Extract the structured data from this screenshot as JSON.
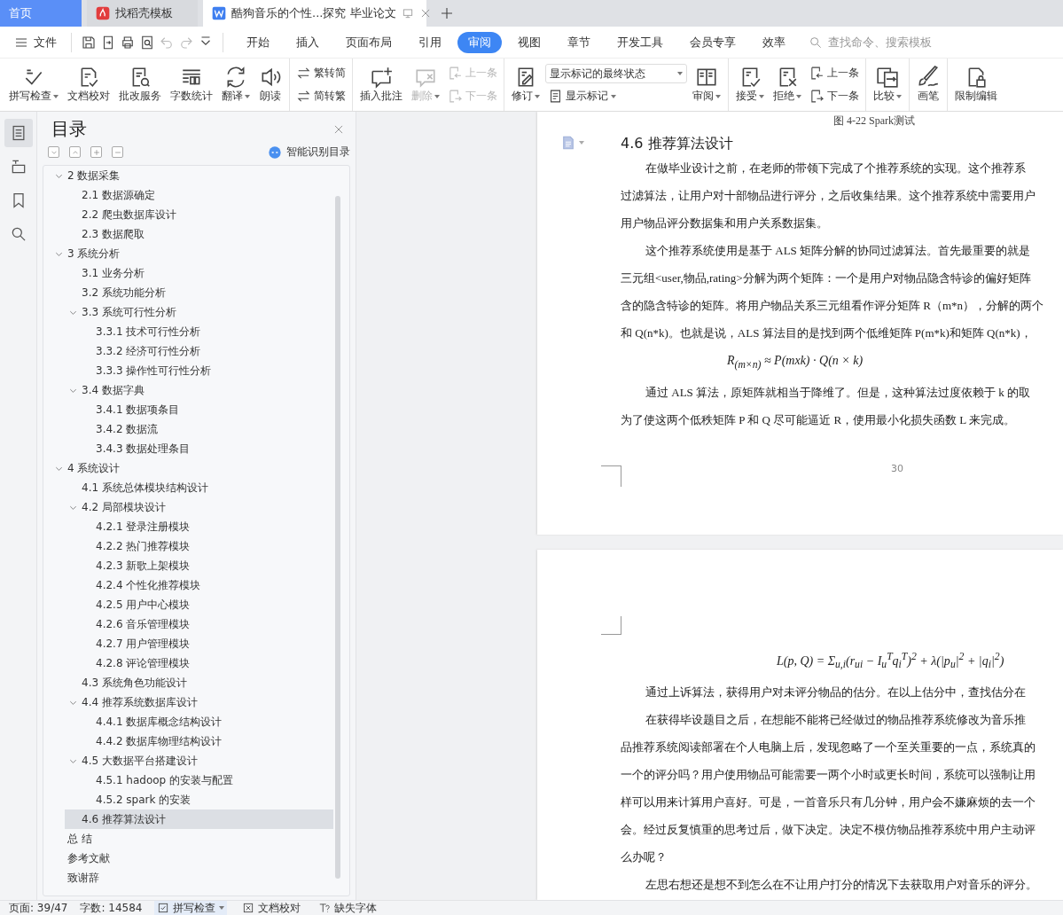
{
  "tabs": [
    {
      "kind": "home",
      "label": "首页",
      "selected": false
    },
    {
      "kind": "store",
      "label": "找稻壳模板",
      "selected": false
    },
    {
      "kind": "document",
      "label": "酷狗音乐的个性...探究 毕业论文",
      "selected": true
    }
  ],
  "menu_bar": {
    "file_menu": "文件",
    "quick_access": [
      {
        "disabled": false
      },
      {
        "disabled": false
      },
      {
        "disabled": false
      },
      {
        "disabled": false
      },
      {
        "disabled": true
      },
      {
        "disabled": true
      },
      {
        "disabled": false
      }
    ],
    "ribbon_tabs": [
      {
        "label": "开始",
        "selected": false
      },
      {
        "label": "插入",
        "selected": false
      },
      {
        "label": "页面布局",
        "selected": false
      },
      {
        "label": "引用",
        "selected": false
      },
      {
        "label": "审阅",
        "selected": true
      },
      {
        "label": "视图",
        "selected": false
      },
      {
        "label": "章节",
        "selected": false
      },
      {
        "label": "开发工具",
        "selected": false
      },
      {
        "label": "会员专享",
        "selected": false
      },
      {
        "label": "效率",
        "selected": false
      }
    ],
    "search": {
      "placeholder": "查找命令、搜索模板"
    }
  },
  "ribbon": {
    "groups": [
      {
        "tools": [
          {
            "kind": "large",
            "label": "拼写检查",
            "dropdown": true,
            "disabled": false
          },
          {
            "kind": "large",
            "label": "文档校对",
            "dropdown": false,
            "disabled": false
          },
          {
            "kind": "large",
            "label": "批改服务",
            "dropdown": false,
            "disabled": false
          },
          {
            "kind": "large",
            "label": "字数统计",
            "dropdown": false,
            "disabled": false
          },
          {
            "kind": "large",
            "label": "翻译",
            "dropdown": true,
            "disabled": false
          },
          {
            "kind": "large",
            "label": "朗读",
            "dropdown": false,
            "disabled": false
          }
        ]
      },
      {
        "tools": [
          {
            "kind": "stack",
            "items": [
              {
                "label": "繁转简",
                "dropdown": false,
                "disabled": false
              },
              {
                "label": "简转繁",
                "dropdown": false,
                "disabled": false
              }
            ]
          }
        ]
      },
      {
        "tools": [
          {
            "kind": "large",
            "label": "插入批注",
            "dropdown": false,
            "disabled": false
          },
          {
            "kind": "large",
            "label": "删除",
            "dropdown": true,
            "disabled": true
          },
          {
            "kind": "stack",
            "items": [
              {
                "label": "上一条",
                "dropdown": false,
                "disabled": true
              },
              {
                "label": "下一条",
                "dropdown": false,
                "disabled": true
              }
            ]
          }
        ]
      },
      {
        "tools": [
          {
            "kind": "large",
            "label": "修订",
            "dropdown": true,
            "disabled": false
          },
          {
            "kind": "select_stack",
            "select": {
              "value": "显示标记的最终状态"
            },
            "item": {
              "label": "显示标记",
              "dropdown": true,
              "disabled": false
            }
          },
          {
            "kind": "large",
            "label": "审阅",
            "dropdown": true,
            "disabled": false
          }
        ]
      },
      {
        "tools": [
          {
            "kind": "large",
            "label": "接受",
            "dropdown": true,
            "disabled": false
          },
          {
            "kind": "large",
            "label": "拒绝",
            "dropdown": true,
            "disabled": false
          },
          {
            "kind": "stack",
            "items": [
              {
                "label": "上一条",
                "dropdown": false,
                "disabled": false
              },
              {
                "label": "下一条",
                "dropdown": false,
                "disabled": false
              }
            ]
          }
        ]
      },
      {
        "tools": [
          {
            "kind": "large",
            "label": "比较",
            "dropdown": true,
            "disabled": false
          }
        ]
      },
      {
        "tools": [
          {
            "kind": "large",
            "label": "画笔",
            "dropdown": false,
            "disabled": false
          }
        ]
      },
      {
        "tools": [
          {
            "kind": "large",
            "label": "限制编辑",
            "dropdown": false,
            "disabled": false
          }
        ]
      }
    ]
  },
  "nav_rail": [
    {
      "selected": true
    },
    {
      "selected": false
    },
    {
      "selected": false
    },
    {
      "selected": false
    }
  ],
  "toc_panel": {
    "title": "目录",
    "smart_button": "智能识别目录",
    "items": [
      {
        "label": "2 数据采集",
        "selected": false,
        "expanded": true,
        "children": [
          {
            "label": "2.1 数据源确定",
            "selected": false
          },
          {
            "label": "2.2 爬虫数据库设计",
            "selected": false
          },
          {
            "label": "2.3 数据爬取",
            "selected": false
          }
        ]
      },
      {
        "label": "3 系统分析",
        "selected": false,
        "expanded": true,
        "children": [
          {
            "label": "3.1 业务分析",
            "selected": false
          },
          {
            "label": "3.2 系统功能分析",
            "selected": false
          },
          {
            "label": "3.3  系统可行性分析",
            "selected": false,
            "expanded": true,
            "children": [
              {
                "label": "3.3.1  技术可行性分析",
                "selected": false
              },
              {
                "label": "3.3.2  经济可行性分析",
                "selected": false
              },
              {
                "label": "3.3.3  操作性可行性分析",
                "selected": false
              }
            ]
          },
          {
            "label": "3.4  数据字典",
            "selected": false,
            "expanded": true,
            "children": [
              {
                "label": "3.4.1  数据项条目",
                "selected": false
              },
              {
                "label": "3.4.2  数据流",
                "selected": false
              },
              {
                "label": "3.4.3  数据处理条目",
                "selected": false
              }
            ]
          }
        ]
      },
      {
        "label": "4  系统设计",
        "selected": false,
        "expanded": true,
        "children": [
          {
            "label": "4.1 系统总体模块结构设计",
            "selected": false
          },
          {
            "label": "4.2  局部模块设计",
            "selected": false,
            "expanded": true,
            "children": [
              {
                "label": "4.2.1  登录注册模块",
                "selected": false
              },
              {
                "label": "4.2.2  热门推荐模块",
                "selected": false
              },
              {
                "label": "4.2.3  新歌上架模块",
                "selected": false
              },
              {
                "label": "4.2.4  个性化推荐模块",
                "selected": false
              },
              {
                "label": "4.2.5  用户中心模块",
                "selected": false
              },
              {
                "label": "4.2.6  音乐管理模块",
                "selected": false
              },
              {
                "label": "4.2.7  用户管理模块",
                "selected": false
              },
              {
                "label": "4.2.8  评论管理模块",
                "selected": false
              }
            ]
          },
          {
            "label": "4.3  系统角色功能设计",
            "selected": false
          },
          {
            "label": "4.4  推荐系统数据库设计",
            "selected": false,
            "expanded": true,
            "children": [
              {
                "label": "4.4.1  数据库概念结构设计",
                "selected": false
              },
              {
                "label": "4.4.2  数据库物理结构设计",
                "selected": false
              }
            ]
          },
          {
            "label": "4.5  大数据平台搭建设计",
            "selected": false,
            "expanded": true,
            "children": [
              {
                "label": "4.5.1 hadoop 的安装与配置",
                "selected": false
              },
              {
                "label": "4.5.2 spark 的安装",
                "selected": false
              }
            ]
          },
          {
            "label": "4.6  推荐算法设计",
            "selected": true
          }
        ]
      },
      {
        "label": "总    结",
        "selected": false
      },
      {
        "label": "参考文献",
        "selected": false
      },
      {
        "label": "致谢辞",
        "selected": false
      }
    ]
  },
  "document": {
    "pages": [
      {
        "blocks": [
          {
            "kind": "caption",
            "text": "图 4-22 Spark测试"
          },
          {
            "kind": "heading",
            "text": "4.6  推荐算法设计"
          },
          {
            "kind": "paragraph",
            "lines": [
              "在做毕业设计之前，在老师的带领下完成了个推荐系统的实现。这个推荐系",
              "过滤算法，让用户对十部物品进行评分，之后收集结果。这个推荐系统中需要用户",
              "用户物品评分数据集和用户关系数据集。"
            ]
          },
          {
            "kind": "paragraph",
            "lines": [
              "这个推荐系统使用是基于 ALS 矩阵分解的协同过滤算法。首先最重要的就是",
              "三元组<user,物品,rating>分解为两个矩阵：一个是用户对物品隐含特诊的偏好矩阵",
              "含的隐含特诊的矩阵。将用户物品关系三元组看作评分矩阵 R（m*n），分解的两个",
              "和 Q(n*k)。也就是说，ALS 算法目的是找到两个低维矩阵 P(m*k)和矩阵 Q(n*k)，"
            ]
          },
          {
            "kind": "formula",
            "text": "R$_{(m×n)}$ ≈ P(mxk) · Q(n × k)"
          },
          {
            "kind": "paragraph",
            "lines": [
              "通过 ALS 算法，原矩阵就相当于降维了。但是，这种算法过度依赖于 k 的取",
              "为了使这两个低秩矩阵 P 和 Q 尽可能逼近 R，使用最小化损失函数 L 来完成。"
            ]
          },
          {
            "kind": "page_number",
            "text": "30"
          }
        ]
      },
      {
        "blocks": [
          {
            "kind": "formula",
            "text": "L(p, Q) = Σ$_{u,i}$(r$_{ui}$ − I$_{u}$$^{T}$q$_{i}$$^{T}$)$^{2}$ + λ(|p$_{u}$|$^{2}$ + |q$_{i}$|$^{2}$)"
          },
          {
            "kind": "paragraph",
            "lines": [
              "通过上诉算法，获得用户对未评分物品的估分。在以上估分中，查找估分在"
            ]
          },
          {
            "kind": "paragraph",
            "lines": [
              "在获得毕设题目之后，在想能不能将已经做过的物品推荐系统修改为音乐推",
              "品推荐系统阅读部署在个人电脑上后，发现忽略了一个至关重要的一点，系统真的",
              "一个的评分吗？用户使用物品可能需要一两个小时或更长时间，系统可以强制让用",
              "样可以用来计算用户喜好。可是，一首音乐只有几分钟，用户会不嫌麻烦的去一个",
              "会。经过反复慎重的思考过后，做下决定。决定不模仿物品推荐系统中用户主动评",
              "么办呢？"
            ]
          },
          {
            "kind": "paragraph",
            "lines": [
              "左思右想还是想不到怎么在不让用户打分的情况下去获取用户对音乐的评分。"
            ]
          }
        ]
      }
    ]
  },
  "status_bar": {
    "page": "页面: 39/47",
    "words": "字数: 14584",
    "spell_check": "拼写检查",
    "proofread": "文档校对",
    "missing_fonts": "缺失字体"
  }
}
